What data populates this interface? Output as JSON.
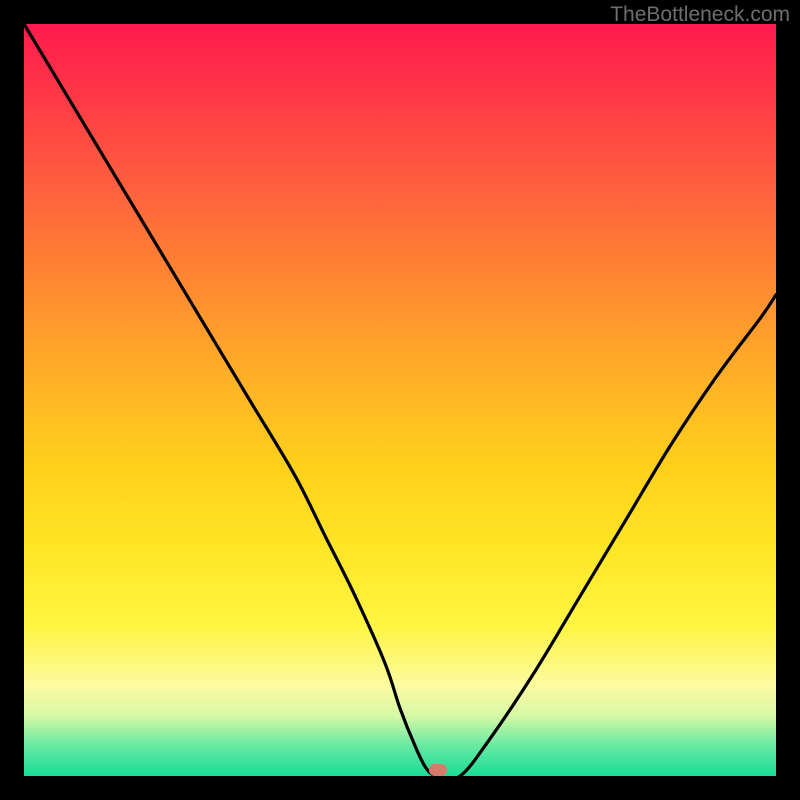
{
  "watermark": "TheBottleneck.com",
  "colors": {
    "frame_bg": "#000000",
    "curve_stroke": "#000000",
    "marker_fill": "#d87a6a",
    "gradient_top": "#ff1a4d",
    "gradient_bottom": "#19dd97"
  },
  "chart_data": {
    "type": "line",
    "title": "",
    "xlabel": "",
    "ylabel": "",
    "xlim": [
      0,
      100
    ],
    "ylim": [
      0,
      100
    ],
    "grid": false,
    "legend": false,
    "series": [
      {
        "name": "bottleneck-curve",
        "x": [
          0,
          6,
          12,
          18,
          24,
          30,
          36,
          40,
          44,
          48,
          50,
          52,
          53.5,
          55,
          58,
          62,
          68,
          74,
          80,
          86,
          92,
          98,
          100
        ],
        "values": [
          100,
          90,
          80,
          70,
          60,
          50,
          40,
          32,
          24,
          15,
          9,
          4,
          1,
          0,
          0,
          5,
          14,
          24,
          34,
          44,
          53,
          61,
          64
        ]
      }
    ],
    "marker": {
      "x": 55,
      "y": 0.8
    }
  }
}
